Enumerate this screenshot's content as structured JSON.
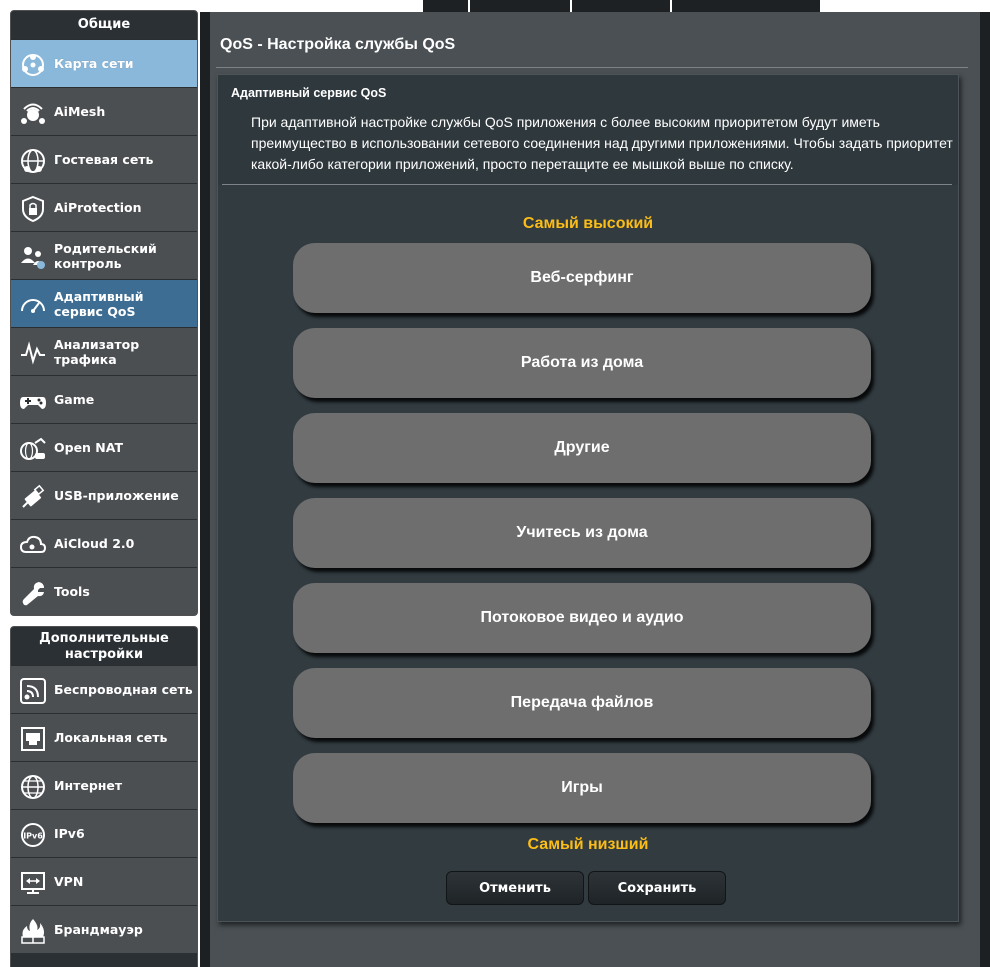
{
  "sidebar": {
    "general_title": "Общие",
    "general_items": [
      {
        "label": "Карта сети",
        "icon": "network-map-icon"
      },
      {
        "label": "AiMesh",
        "icon": "aimesh-icon"
      },
      {
        "label": "Гостевая сеть",
        "icon": "guest-network-icon"
      },
      {
        "label": "AiProtection",
        "icon": "shield-lock-icon"
      },
      {
        "label": "Родительский контроль",
        "icon": "parental-control-icon"
      },
      {
        "label": "Адаптивный сервис QoS",
        "icon": "speedometer-icon"
      },
      {
        "label": "Анализатор трафика",
        "icon": "traffic-analyzer-icon"
      },
      {
        "label": "Game",
        "icon": "gamepad-icon"
      },
      {
        "label": "Open NAT",
        "icon": "open-nat-icon"
      },
      {
        "label": "USB-приложение",
        "icon": "usb-icon"
      },
      {
        "label": "AiCloud 2.0",
        "icon": "cloud-icon"
      },
      {
        "label": "Tools",
        "icon": "wrench-icon"
      }
    ],
    "advanced_title": "Дополнительные настройки",
    "advanced_items": [
      {
        "label": "Беспроводная сеть",
        "icon": "wireless-icon"
      },
      {
        "label": "Локальная сеть",
        "icon": "lan-icon"
      },
      {
        "label": "Интернет",
        "icon": "globe-icon"
      },
      {
        "label": "IPv6",
        "icon": "ipv6-icon"
      },
      {
        "label": "VPN",
        "icon": "vpn-icon"
      },
      {
        "label": "Брандмауэр",
        "icon": "firewall-icon"
      }
    ]
  },
  "page": {
    "title": "QoS - Настройка службы QoS",
    "section_title": "Адаптивный сервис QoS",
    "description": "При адаптивной настройке службы QoS приложения с более высоким приоритетом будут иметь преимущество в использовании сетевого соединения над другими приложениями. Чтобы задать приоритет какой-либо категории приложений, просто перетащите ее мышкой выше по списку.",
    "priority_high": "Самый высокий",
    "priority_low": "Самый низший",
    "categories": [
      "Веб-серфинг",
      "Работа из дома",
      "Другие",
      "Учитесь из дома",
      "Потоковое видео и аудио",
      "Передача файлов",
      "Игры"
    ],
    "cancel_label": "Отменить",
    "save_label": "Сохранить"
  },
  "colors": {
    "accent_yellow": "#fbbd16",
    "active_menu": "#8ab8da",
    "category_bg": "#6e6e6e"
  }
}
